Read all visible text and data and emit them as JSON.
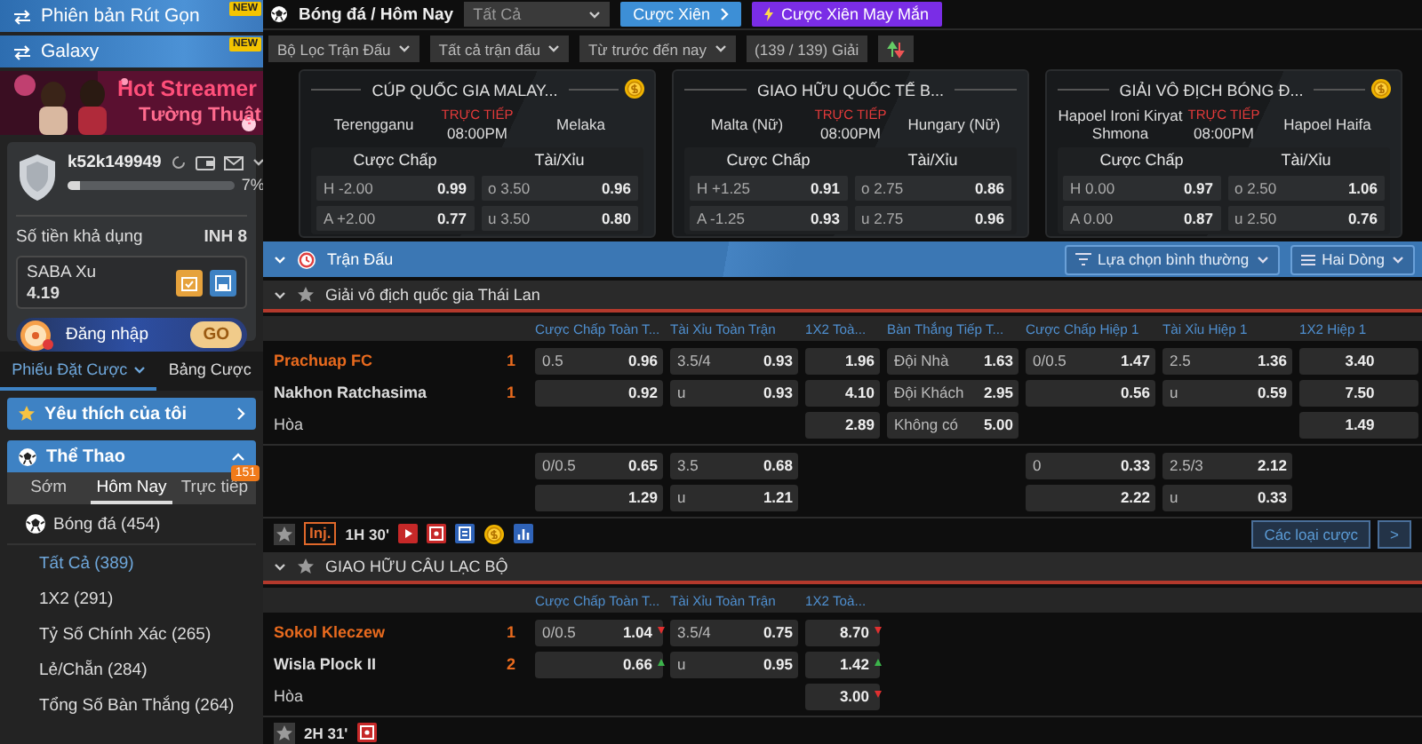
{
  "sidebar": {
    "banners": [
      {
        "label": "Phiên bản Rút Gọn",
        "badge": "NEW"
      },
      {
        "label": "Galaxy",
        "badge": "NEW"
      }
    ],
    "promo": {
      "title": "Hot Streamer",
      "subtitle": "Tường Thuật"
    },
    "account": {
      "username": "k52k149949",
      "level": 0.07,
      "percent": "7%",
      "balance_label": "Số tiền khả dụng",
      "balance": "INH 8",
      "xu_label": "SABA Xu",
      "xu_value": "4.19",
      "login": "Đăng nhập",
      "go": "GO"
    },
    "tabs": [
      {
        "label": "Phiếu Đặt Cược",
        "selected": true
      },
      {
        "label": "Bảng Cược",
        "selected": false
      }
    ],
    "favorites": {
      "label": "Yêu thích của tôi"
    },
    "sports": {
      "label": "Thể Thao",
      "expanded": true
    },
    "period_tabs": [
      {
        "label": "Sớm",
        "selected": false
      },
      {
        "label": "Hôm Nay",
        "selected": true
      },
      {
        "label": "Trực tiếp",
        "selected": false,
        "badge": "151"
      }
    ],
    "sport": {
      "label": "Bóng đá (454)"
    },
    "bet_types": [
      {
        "label": "Tất Cả (389)",
        "selected": true
      },
      {
        "label": "1X2 (291)",
        "selected": false
      },
      {
        "label": "Tỷ Số Chính Xác (265)",
        "selected": false
      },
      {
        "label": "Lẻ/Chẵn (284)",
        "selected": false
      },
      {
        "label": "Tổng Số Bàn Thắng (264)",
        "selected": false
      }
    ]
  },
  "header": {
    "breadcrumb": "Bóng đá / Hôm Nay",
    "select": "Tất Cả",
    "parlay": "Cược Xiên",
    "lucky": "Cược Xiên May Mắn",
    "filters": [
      "Bộ Lọc Trận Đấu",
      "Tất cả trận đấu",
      "Từ trước đến nay"
    ],
    "count": "(139 / 139) Giải"
  },
  "cards": [
    {
      "title": "CÚP QUỐC GIA MALAY...",
      "coin": true,
      "home": "Terengganu",
      "away": "Melaka",
      "status": "TRỰC TIẾP",
      "time": "08:00PM",
      "markets": [
        "Cược Chấp",
        "Tài/Xỉu"
      ],
      "odds": [
        [
          {
            "label": "H -2.00",
            "odds": "0.99"
          },
          {
            "label": "o 3.50",
            "odds": "0.96"
          }
        ],
        [
          {
            "label": "A +2.00",
            "odds": "0.77"
          },
          {
            "label": "u 3.50",
            "odds": "0.80"
          }
        ]
      ]
    },
    {
      "title": "GIAO HỮU QUỐC TẾ B...",
      "coin": false,
      "home": "Malta (Nữ)",
      "away": "Hungary (Nữ)",
      "status": "TRỰC TIẾP",
      "time": "08:00PM",
      "markets": [
        "Cược Chấp",
        "Tài/Xỉu"
      ],
      "odds": [
        [
          {
            "label": "H +1.25",
            "odds": "0.91"
          },
          {
            "label": "o 2.75",
            "odds": "0.86"
          }
        ],
        [
          {
            "label": "A -1.25",
            "odds": "0.93"
          },
          {
            "label": "u 2.75",
            "odds": "0.96"
          }
        ]
      ]
    },
    {
      "title": "GIẢI VÔ ĐỊCH BÓNG Đ...",
      "coin": true,
      "home": "Hapoel Ironi Kiryat Shmona",
      "away": "Hapoel Haifa",
      "status": "TRỰC TIẾP",
      "time": "08:00PM",
      "markets": [
        "Cược Chấp",
        "Tài/Xỉu"
      ],
      "odds": [
        [
          {
            "label": "H 0.00",
            "odds": "0.97"
          },
          {
            "label": "o 2.50",
            "odds": "1.06"
          }
        ],
        [
          {
            "label": "A 0.00",
            "odds": "0.87"
          },
          {
            "label": "u 2.50",
            "odds": "0.76"
          }
        ]
      ]
    }
  ],
  "section": {
    "title": "Trận Đấu",
    "options": [
      "Lựa chọn bình thường",
      "Hai Dòng"
    ]
  },
  "leagues": [
    {
      "name": "Giải vô địch quốc gia Thái Lan",
      "columns": [
        "Cược Chấp Toàn T...",
        "Tài Xỉu Toàn Trận",
        "1X2 Toà...",
        "Bàn Thắng Tiếp T...",
        "Cược Chấp Hiệp 1",
        "Tài Xỉu Hiệp 1",
        "1X2 Hiệp 1"
      ],
      "matches": [
        {
          "teams": [
            {
              "kind": "team",
              "name": "Prachuap FC",
              "score": "1",
              "favorite": true
            },
            {
              "kind": "team",
              "name": "Nakhon Ratchasima",
              "score": "1",
              "favorite": false
            },
            {
              "kind": "draw",
              "name": "Hòa"
            }
          ],
          "lines": [
            [
              [
                {
                  "kind": "odds",
                  "label": "0.5",
                  "odds": "0.96"
                },
                {
                  "kind": "odds",
                  "label": "3.5/4",
                  "odds": "0.93"
                },
                {
                  "kind": "odds",
                  "odds": "1.96"
                },
                {
                  "kind": "odds",
                  "label": "Đội Nhà",
                  "odds": "1.63"
                },
                {
                  "kind": "odds",
                  "label": "0/0.5",
                  "odds": "1.47"
                },
                {
                  "kind": "odds",
                  "label": "2.5",
                  "odds": "1.36"
                },
                {
                  "kind": "odds",
                  "odds": "3.40"
                }
              ],
              [
                {
                  "kind": "odds",
                  "odds": "0.92"
                },
                {
                  "kind": "odds",
                  "label": "u",
                  "odds": "0.93"
                },
                {
                  "kind": "odds",
                  "odds": "4.10"
                },
                {
                  "kind": "odds",
                  "label": "Đội Khách",
                  "odds": "2.95"
                },
                {
                  "kind": "odds",
                  "odds": "0.56"
                },
                {
                  "kind": "odds",
                  "label": "u",
                  "odds": "0.59"
                },
                {
                  "kind": "odds",
                  "odds": "7.50"
                }
              ],
              [
                {
                  "kind": "blank"
                },
                {
                  "kind": "blank"
                },
                {
                  "kind": "odds",
                  "odds": "2.89"
                },
                {
                  "kind": "odds",
                  "label": "Không có",
                  "odds": "5.00"
                },
                {
                  "kind": "blank"
                },
                {
                  "kind": "blank"
                },
                {
                  "kind": "odds",
                  "odds": "1.49"
                }
              ]
            ],
            [
              [
                {
                  "kind": "odds",
                  "label": "0/0.5",
                  "odds": "0.65"
                },
                {
                  "kind": "odds",
                  "label": "3.5",
                  "odds": "0.68"
                },
                {
                  "kind": "blank"
                },
                {
                  "kind": "blank"
                },
                {
                  "kind": "odds",
                  "label": "0",
                  "odds": "0.33"
                },
                {
                  "kind": "odds",
                  "label": "2.5/3",
                  "odds": "2.12"
                },
                {
                  "kind": "blank"
                }
              ],
              [
                {
                  "kind": "odds",
                  "odds": "1.29"
                },
                {
                  "kind": "odds",
                  "label": "u",
                  "odds": "1.21"
                },
                {
                  "kind": "blank"
                },
                {
                  "kind": "blank"
                },
                {
                  "kind": "odds",
                  "odds": "2.22"
                },
                {
                  "kind": "odds",
                  "label": "u",
                  "odds": "0.33"
                },
                {
                  "kind": "blank"
                }
              ]
            ]
          ],
          "footer": {
            "inj": "Inj.",
            "clock": "1H 30'",
            "icons": [
              {
                "kind": "video"
              },
              {
                "kind": "lineup"
              },
              {
                "kind": "list"
              },
              {
                "kind": "coin"
              },
              {
                "kind": "stats"
              }
            ],
            "more": "Các loại cược",
            "nav": ">"
          }
        }
      ]
    },
    {
      "name": "GIAO HỮU CÂU LẠC BỘ",
      "columns": [
        "Cược Chấp Toàn T...",
        "Tài Xỉu Toàn Trận",
        "1X2 Toà..."
      ],
      "matches": [
        {
          "teams": [
            {
              "kind": "team",
              "name": "Sokol Kleczew",
              "score": "1",
              "favorite": true
            },
            {
              "kind": "team",
              "name": "Wisla Plock II",
              "score": "2",
              "favorite": false
            },
            {
              "kind": "draw",
              "name": "Hòa"
            }
          ],
          "lines": [
            [
              [
                {
                  "kind": "odds",
                  "label": "0/0.5",
                  "odds": "1.04",
                  "rising": false
                },
                {
                  "kind": "odds",
                  "label": "3.5/4",
                  "odds": "0.75"
                },
                {
                  "kind": "odds",
                  "odds": "8.70",
                  "rising": false
                }
              ],
              [
                {
                  "kind": "odds",
                  "odds": "0.66",
                  "rising": true
                },
                {
                  "kind": "odds",
                  "label": "u",
                  "odds": "0.95"
                },
                {
                  "kind": "odds",
                  "odds": "1.42",
                  "rising": true
                }
              ],
              [
                {
                  "kind": "blank"
                },
                {
                  "kind": "blank"
                },
                {
                  "kind": "odds",
                  "odds": "3.00",
                  "rising": false
                }
              ]
            ]
          ],
          "footer": {
            "clock": "2H 31'",
            "icons": [
              {
                "kind": "lineup"
              }
            ]
          }
        }
      ]
    }
  ]
}
